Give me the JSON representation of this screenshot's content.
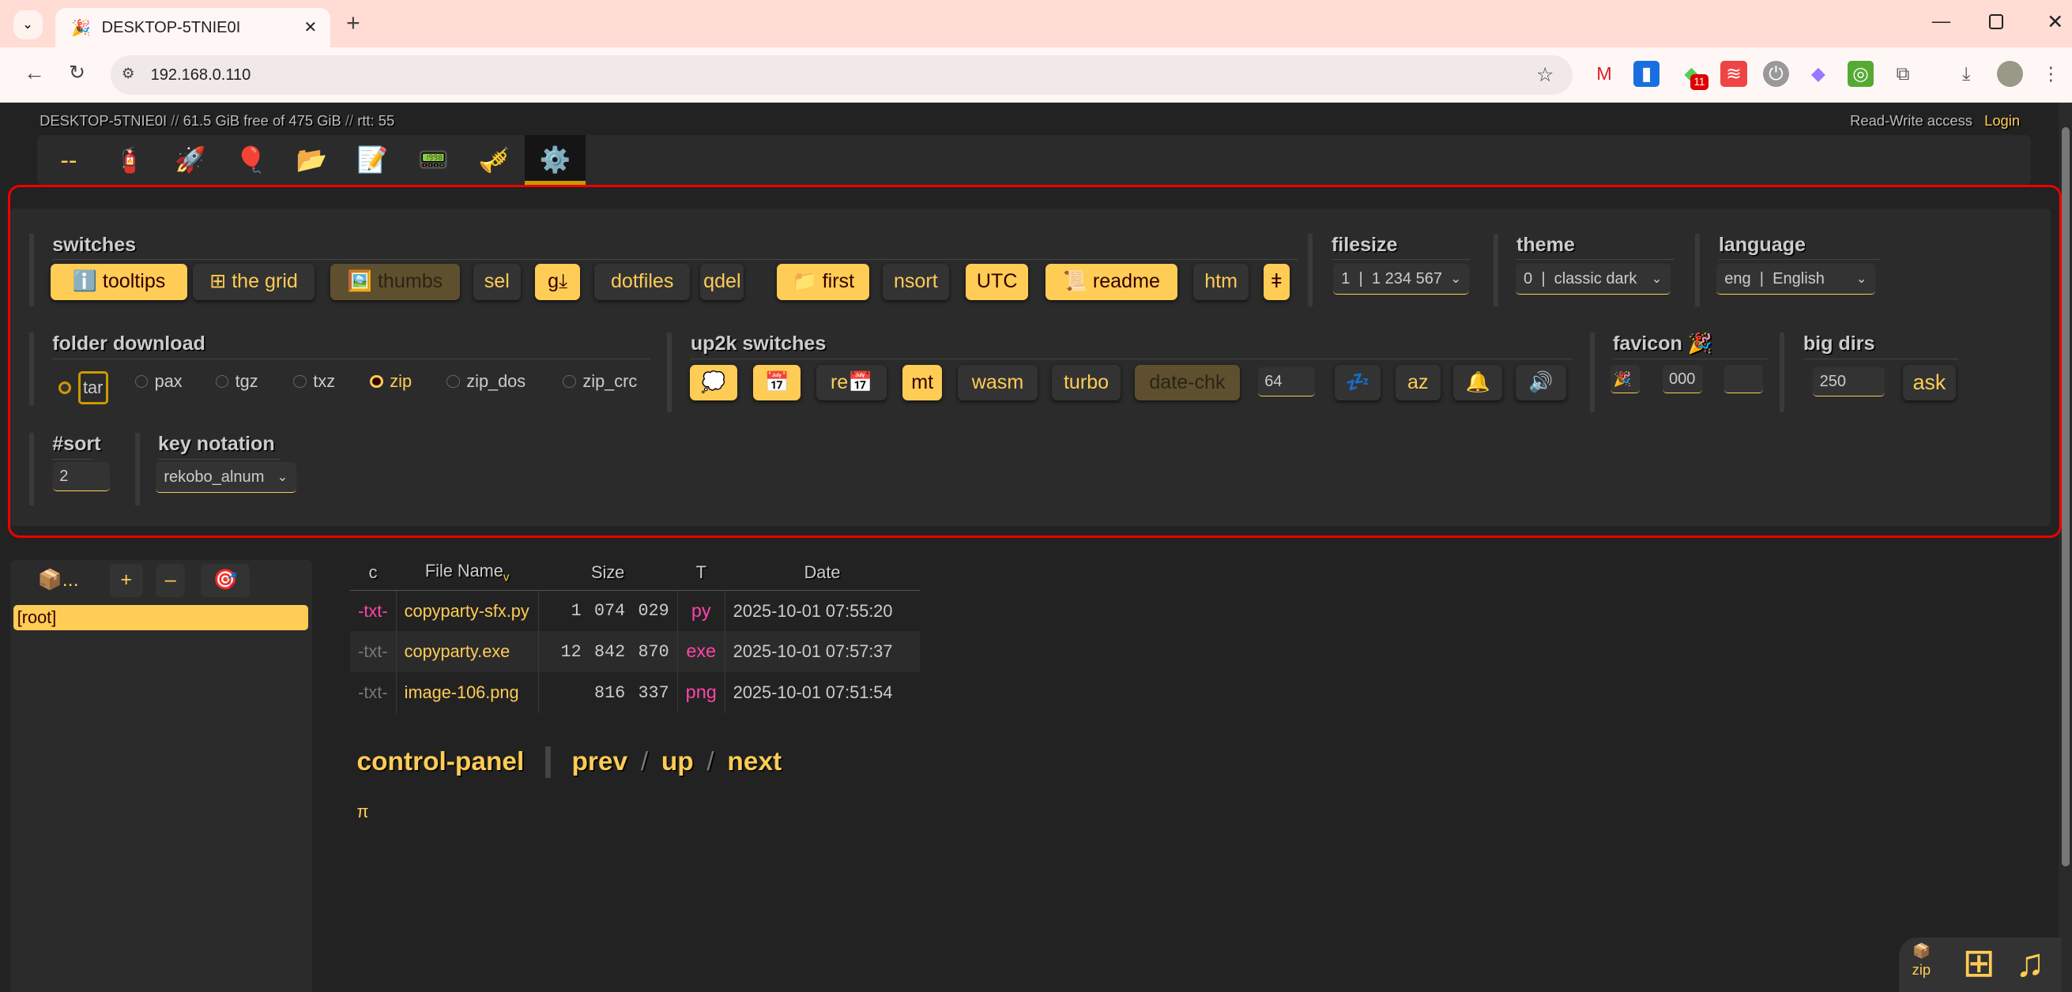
{
  "browser": {
    "tab_title": "DESKTOP-5TNIE0I",
    "url": "192.168.0.110",
    "ext_badge": "11"
  },
  "header": {
    "host": "DESKTOP-5TNIE0I",
    "sep": " // ",
    "disk": "61.5 GiB free of 475 GiB",
    "rtt": "rtt: 55",
    "access": "Read-Write access",
    "login": "Login"
  },
  "ops": [
    {
      "icon": "--",
      "name": "ops-none"
    },
    {
      "icon": "🧯",
      "name": "ops-unpost"
    },
    {
      "icon": "🚀",
      "name": "ops-up2k"
    },
    {
      "icon": "🎈",
      "name": "ops-bup"
    },
    {
      "icon": "📂",
      "name": "ops-mkdir"
    },
    {
      "icon": "📝",
      "name": "ops-new-md"
    },
    {
      "icon": "📟",
      "name": "ops-msg"
    },
    {
      "icon": "🎺",
      "name": "ops-player"
    },
    {
      "icon": "⚙️",
      "name": "ops-settings"
    }
  ],
  "switches": {
    "title": "switches",
    "buttons": [
      {
        "label": "ℹ️ tooltips",
        "state": "on"
      },
      {
        "label": "⊞ the grid",
        "state": "off"
      },
      {
        "label": "🖼️ thumbs",
        "state": "dim"
      },
      {
        "label": "sel",
        "state": "off"
      },
      {
        "label": "g⤓",
        "state": "on"
      },
      {
        "label": "dotfiles",
        "state": "off"
      },
      {
        "label": "qdel",
        "state": "off"
      },
      {
        "label": "📁 first",
        "state": "on"
      },
      {
        "label": "nsort",
        "state": "off"
      },
      {
        "label": "UTC",
        "state": "on"
      },
      {
        "label": "📜 readme",
        "state": "on"
      },
      {
        "label": "htm",
        "state": "off"
      },
      {
        "label": "ǂ",
        "state": "on"
      }
    ]
  },
  "filesize": {
    "title": "filesize",
    "value": "1  |  1 234 567"
  },
  "theme": {
    "title": "theme",
    "value": "0  |  classic dark"
  },
  "language": {
    "title": "language",
    "value": "eng  |  English"
  },
  "folder_download": {
    "title": "folder download",
    "options": [
      "tar",
      "pax",
      "tgz",
      "txz",
      "zip",
      "zip_dos",
      "zip_crc"
    ],
    "selected": "zip"
  },
  "up2k": {
    "title": "up2k switches",
    "buttons": [
      {
        "label": "💭",
        "state": "on"
      },
      {
        "label": "📅",
        "state": "on"
      },
      {
        "label": "re📅",
        "state": "off"
      },
      {
        "label": "mt",
        "state": "on"
      },
      {
        "label": "wasm",
        "state": "off"
      },
      {
        "label": "turbo",
        "state": "off"
      },
      {
        "label": "date-chk",
        "state": "dim"
      }
    ],
    "threads": "64",
    "buttons2": [
      {
        "label": "💤"
      },
      {
        "label": "az"
      },
      {
        "label": "🔔"
      },
      {
        "label": "🔊"
      }
    ]
  },
  "favicon": {
    "title": "favicon 🎉",
    "emoji": "🎉",
    "fg": "000",
    "bg": ""
  },
  "bigdirs": {
    "title": "big dirs",
    "value": "250",
    "ask": "ask"
  },
  "sort": {
    "title": "#sort",
    "value": "2"
  },
  "key_notation": {
    "title": "key notation",
    "value": "rekobo_alnum"
  },
  "tree": {
    "buttons": [
      "📦...",
      "+",
      "–",
      "🎯"
    ],
    "root": "[root]"
  },
  "files": {
    "headers": [
      "c",
      "File Name",
      "Size",
      "T",
      "Date"
    ],
    "sort_indicator": "v",
    "rows": [
      {
        "c": "-txt-",
        "name": "copyparty-sfx.py",
        "size": "1 074 029",
        "ext": "py",
        "date": "2025-10-01 07:55:20"
      },
      {
        "c": "-txt-",
        "name": "copyparty.exe",
        "size": "12 842 870",
        "ext": "exe",
        "date": "2025-10-01 07:57:37"
      },
      {
        "c": "-txt-",
        "name": "image-106.png",
        "size": "816 337",
        "ext": "png",
        "date": "2025-10-01 07:51:54"
      }
    ]
  },
  "nav": {
    "title": "control-panel",
    "prev": "prev",
    "up": "up",
    "next": "next",
    "slash": "/"
  },
  "pi": "π",
  "widget": {
    "zip_icon": "📦",
    "zip": "zip",
    "grid": "⊞",
    "music": "♫"
  }
}
